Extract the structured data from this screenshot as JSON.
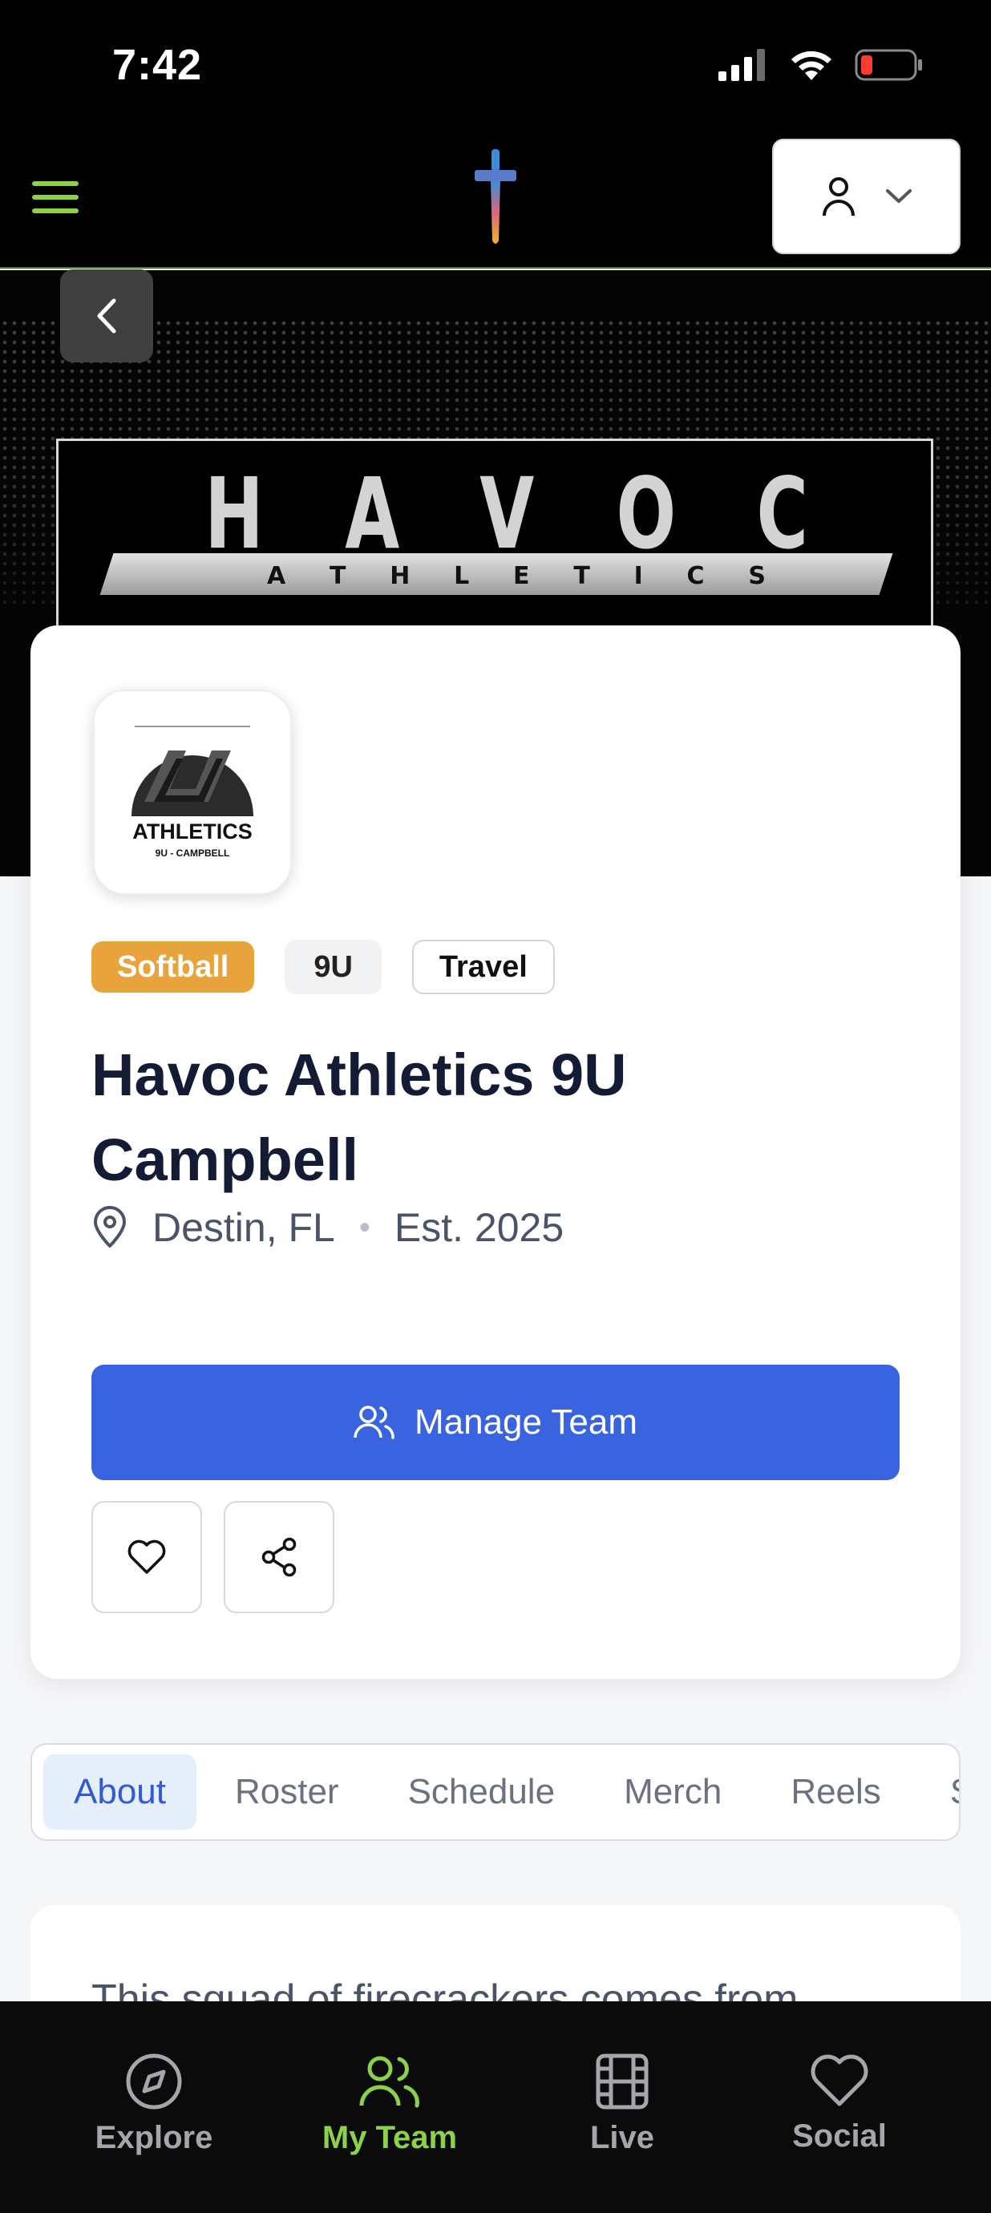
{
  "status_bar": {
    "time": "7:42"
  },
  "hero": {
    "banner_word": [
      "H",
      "A",
      "V",
      "O",
      "C"
    ],
    "banner_sub": [
      "A",
      "T",
      "H",
      "L",
      "E",
      "T",
      "I",
      "C",
      "S"
    ]
  },
  "team_logo": {
    "line1": "ATHLETICS",
    "line2": "9U - CAMPBELL"
  },
  "team": {
    "tags": {
      "sport": "Softball",
      "age": "9U",
      "type": "Travel"
    },
    "name": "Havoc Athletics 9U Campbell",
    "location": "Destin, FL",
    "established": "Est. 2025",
    "manage_label": "Manage Team"
  },
  "tabs": [
    {
      "label": "About",
      "active": true
    },
    {
      "label": "Roster"
    },
    {
      "label": "Schedule"
    },
    {
      "label": "Merch"
    },
    {
      "label": "Reels"
    },
    {
      "label": "S"
    }
  ],
  "about": {
    "text": "This squad of firecrackers comes from"
  },
  "bottom_nav": [
    {
      "label": "Explore",
      "icon": "compass-icon"
    },
    {
      "label": "My Team",
      "icon": "users-icon",
      "active": true
    },
    {
      "label": "Live",
      "icon": "film-icon"
    },
    {
      "label": "Social",
      "icon": "heart-icon"
    }
  ],
  "colors": {
    "accent_green": "#8bd14a",
    "primary_blue": "#3a63e0",
    "sport_tag": "#e8a33d"
  }
}
